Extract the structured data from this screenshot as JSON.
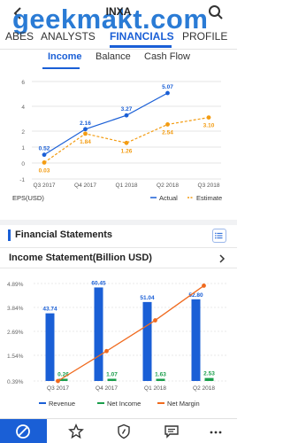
{
  "header": {
    "title": "INXA",
    "watermark": "geekmakt.com"
  },
  "tabs": [
    {
      "label": "ABES",
      "active": false
    },
    {
      "label": "ANALYSTS",
      "active": false
    },
    {
      "label": "FINANCIALS",
      "active": true
    },
    {
      "label": "PROFILE",
      "active": false
    }
  ],
  "subtabs": [
    {
      "label": "Income",
      "active": true
    },
    {
      "label": "Balance",
      "active": false
    },
    {
      "label": "Cash Flow",
      "active": false
    }
  ],
  "chart_data": [
    {
      "type": "line",
      "x": [
        "Q3 2017",
        "Q4 2017",
        "Q1 2018",
        "Q2 2018",
        "Q3 2018"
      ],
      "ylabel": "EPS(USD)",
      "ylim": [
        -1,
        6
      ],
      "yticks": [
        "6",
        "4",
        "2",
        "1",
        "0",
        "-1"
      ],
      "grid": true,
      "legend": "bottom-right",
      "series": [
        {
          "name": "Actual",
          "color": "#1a5fd6",
          "style": "solid",
          "values": [
            0.52,
            2.16,
            3.27,
            5.07,
            null
          ],
          "labels": [
            "0.52",
            "2.16",
            "3.27",
            "5.07",
            ""
          ]
        },
        {
          "name": "Estimate",
          "color": "#f39c12",
          "style": "dashed",
          "values": [
            0.03,
            1.84,
            1.26,
            2.54,
            3.1
          ],
          "labels": [
            "0.03",
            "1.84",
            "1.26",
            "2.54",
            "3.10"
          ]
        }
      ]
    },
    {
      "type": "bar",
      "categories": [
        "Q3 2017",
        "Q4 2017",
        "Q1 2018",
        "Q2 2018"
      ],
      "yticks": [
        "4.89%",
        "3.84%",
        "2.69%",
        "1.54%",
        "0.39%"
      ],
      "legend": "bottom",
      "series": [
        {
          "name": "Revenue",
          "color": "#1a5fd6",
          "values": [
            43.74,
            60.45,
            51.04,
            52.8
          ],
          "labels": [
            "43.74",
            "60.45",
            "51.04",
            "52.80"
          ]
        },
        {
          "name": "Net Income",
          "color": "#1a9e4b",
          "values": [
            0.26,
            1.07,
            1.63,
            2.53
          ],
          "labels": [
            "0.26",
            "1.07",
            "1.63",
            "2.53"
          ]
        },
        {
          "name": "Net Margin",
          "color": "#f06a1e",
          "values": [
            0.39,
            1.77,
            3.19,
            4.79
          ]
        }
      ]
    }
  ],
  "financial_statements": {
    "title": "Financial Statements",
    "statement_title": "Income Statement(Billion  USD)"
  },
  "bottom_nav": [
    {
      "icon": "no-entry-icon",
      "active": true
    },
    {
      "icon": "star-icon",
      "active": false
    },
    {
      "icon": "shield-icon",
      "active": false
    },
    {
      "icon": "chat-icon",
      "active": false
    },
    {
      "icon": "more-icon",
      "active": false
    }
  ]
}
